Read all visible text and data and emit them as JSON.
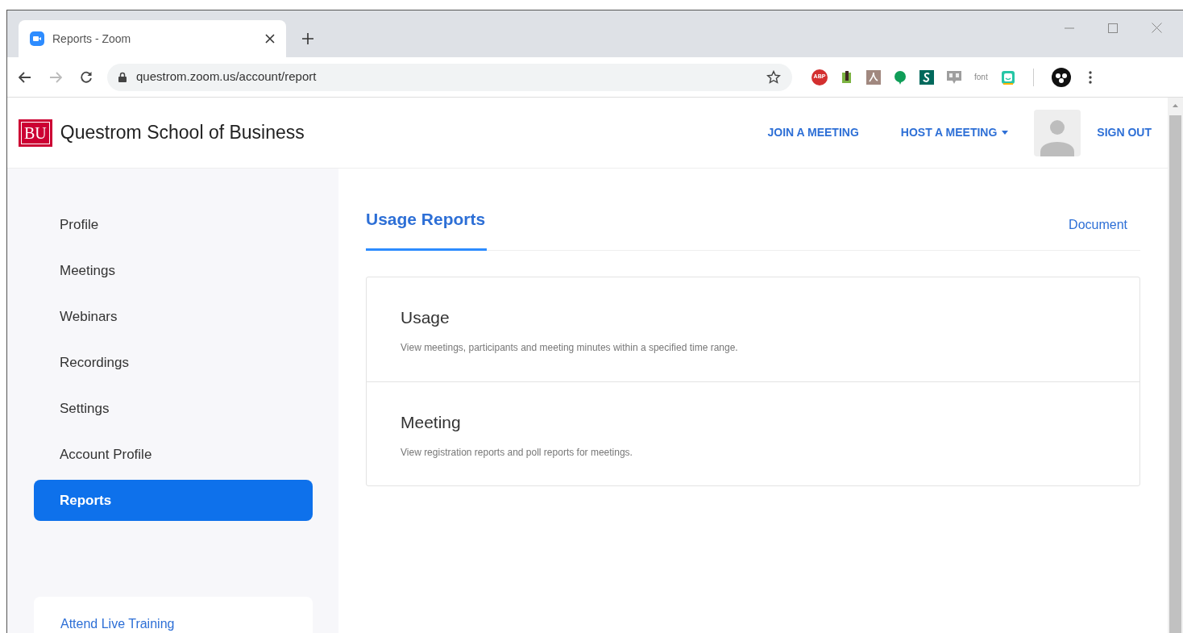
{
  "browser": {
    "tab": {
      "title": "Reports - Zoom"
    },
    "url": "questrom.zoom.us/account/report",
    "extensions": [
      {
        "kind": "abp",
        "label": "ABP"
      },
      {
        "kind": "clip"
      },
      {
        "kind": "pdf"
      },
      {
        "kind": "chat"
      },
      {
        "kind": "s"
      },
      {
        "kind": "cc"
      },
      {
        "kind": "text",
        "label": "font"
      },
      {
        "kind": "face"
      }
    ]
  },
  "header": {
    "logo": "BU",
    "school": "Questrom School of Business",
    "links": [
      {
        "label": "JOIN A MEETING",
        "dropdown": false
      },
      {
        "label": "HOST A MEETING",
        "dropdown": true
      }
    ],
    "sign_out": "SIGN OUT"
  },
  "sidebar": {
    "items": [
      {
        "label": "Profile",
        "selected": false
      },
      {
        "label": "Meetings",
        "selected": false
      },
      {
        "label": "Webinars",
        "selected": false
      },
      {
        "label": "Recordings",
        "selected": false
      },
      {
        "label": "Settings",
        "selected": false
      },
      {
        "label": "Account Profile",
        "selected": false
      },
      {
        "label": "Reports",
        "selected": true
      }
    ],
    "training_link": "Attend Live Training"
  },
  "content": {
    "tabs": [
      {
        "label": "Usage Reports",
        "selected": true
      }
    ],
    "document_link": "Document",
    "reports": [
      {
        "title": "Usage",
        "description": "View meetings, participants and meeting minutes within a specified time range."
      },
      {
        "title": "Meeting",
        "description": "View registration reports and poll reports for meetings."
      }
    ]
  }
}
